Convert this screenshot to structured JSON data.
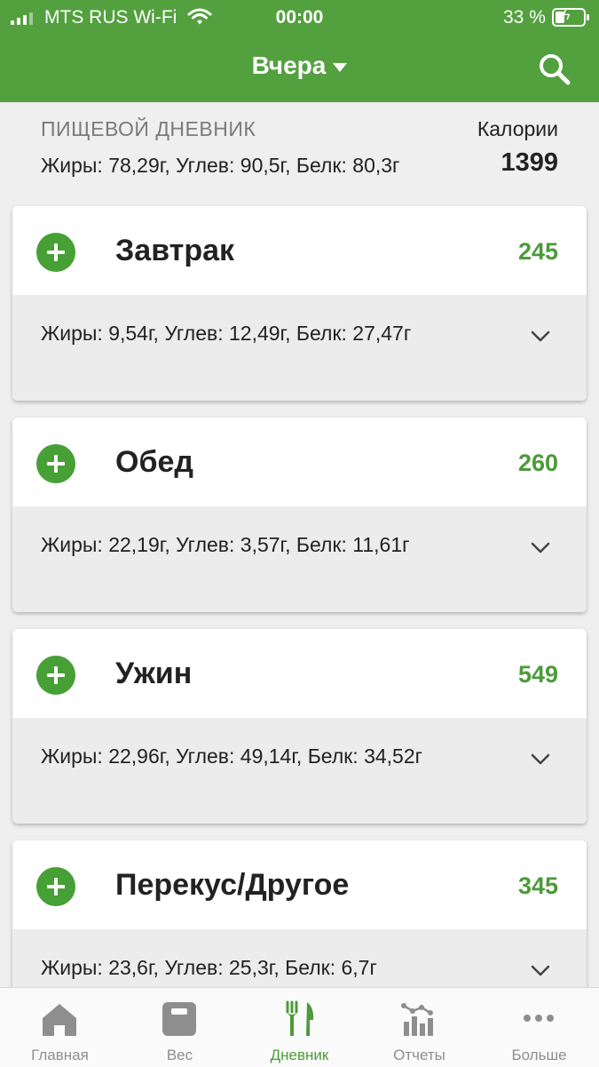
{
  "status_bar": {
    "carrier": "MTS RUS Wi-Fi",
    "time": "00:00",
    "battery": "33 %"
  },
  "header": {
    "title": "Вчера",
    "icons": [
      "chevron-down-icon",
      "search-icon"
    ]
  },
  "summary": {
    "title": "ПИЩЕВОЙ ДНЕВНИК",
    "macros": "Жиры: 78,29г, Углев: 90,5г, Белк: 80,3г",
    "calories_label": "Калории",
    "calories": "1399"
  },
  "meals": [
    {
      "name": "Завтрак",
      "calories": "245",
      "macros": "Жиры: 9,54г, Углев: 12,49г, Белк: 27,47г"
    },
    {
      "name": "Обед",
      "calories": "260",
      "macros": "Жиры: 22,19г, Углев: 3,57г, Белк: 11,61г"
    },
    {
      "name": "Ужин",
      "calories": "549",
      "macros": "Жиры: 22,96г, Углев: 49,14г, Белк: 34,52г"
    },
    {
      "name": "Перекус/Другое",
      "calories": "345",
      "macros": "Жиры: 23,6г, Углев: 25,3г, Белк: 6,7г"
    }
  ],
  "bottom_nav": [
    {
      "label": "Главная",
      "icon": "home-icon"
    },
    {
      "label": "Вес",
      "icon": "scale-icon"
    },
    {
      "label": "Дневник",
      "icon": "fork-knife-icon",
      "active": true
    },
    {
      "label": "Отчеты",
      "icon": "chart-icon"
    },
    {
      "label": "Больше",
      "icon": "more-icon"
    }
  ],
  "colors": {
    "brand_green": "#53a03f",
    "calorie_green": "#4c9a3a",
    "inactive_gray": "#8e8e8e"
  }
}
